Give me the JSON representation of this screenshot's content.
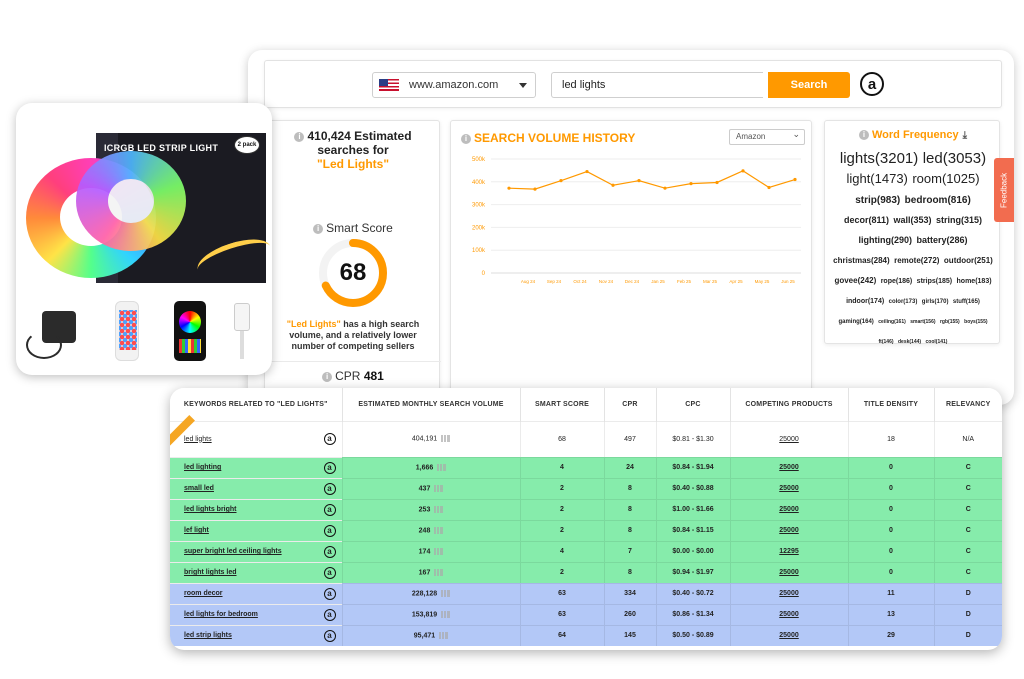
{
  "search": {
    "domain": "www.amazon.com",
    "keyword": "led lights",
    "button_label": "Search"
  },
  "stats": {
    "estimated_title": "410,424 Estimated searches for",
    "keyword_quoted": "\"Led Lights\"",
    "smart_score_label": "Smart Score",
    "smart_score": "68",
    "smart_score_value": 68,
    "desc_kw": "\"Led Lights\"",
    "desc_rest": " has a high search volume, and a relatively lower number of competing sellers",
    "cpr_label": "CPR",
    "cpr_value": "481"
  },
  "chart": {
    "title": "SEARCH VOLUME HISTORY",
    "select_value": "Amazon",
    "accent": "#ff9900"
  },
  "chart_data": {
    "type": "line",
    "title": "SEARCH VOLUME HISTORY",
    "x": [
      "Aug 24",
      "Sep 24",
      "Oct 24",
      "Nov 24",
      "Dec 24",
      "Jan 25",
      "Feb 25",
      "Mar 25",
      "Apr 25",
      "May 25",
      "Jun 25"
    ],
    "series": [
      {
        "values": [
          372000,
          368000,
          405000,
          445000,
          385000,
          405000,
          372000,
          392000,
          397000,
          448000,
          375000,
          410000
        ]
      }
    ],
    "ylim": [
      0,
      500000
    ],
    "yticks": [
      "0",
      "100k",
      "200k",
      "300k",
      "400k",
      "500k"
    ],
    "grid": true
  },
  "word_frequency": {
    "title": "Word Frequency",
    "words": [
      {
        "text": "lights(3201)",
        "size": 15,
        "bold": false
      },
      {
        "text": "led(3053)",
        "size": 15,
        "bold": false
      },
      {
        "text": "light(1473)",
        "size": 13,
        "bold": false
      },
      {
        "text": "room(1025)",
        "size": 13,
        "bold": false
      },
      {
        "text": "strip(983)",
        "size": 10,
        "bold": false
      },
      {
        "text": "bedroom(816)",
        "size": 10,
        "bold": false
      },
      {
        "text": "decor(811)",
        "size": 9,
        "bold": false
      },
      {
        "text": "wall(353)",
        "size": 9,
        "bold": false
      },
      {
        "text": "string(315)",
        "size": 9,
        "bold": false
      },
      {
        "text": "lighting(290)",
        "size": 9,
        "bold": false
      },
      {
        "text": "battery(286)",
        "size": 9,
        "bold": false
      },
      {
        "text": "christmas(284)",
        "size": 8,
        "bold": false
      },
      {
        "text": "remote(272)",
        "size": 8,
        "bold": false
      },
      {
        "text": "outdoor(251)",
        "size": 8,
        "bold": false
      },
      {
        "text": "govee(242)",
        "size": 8,
        "bold": false
      },
      {
        "text": "rope(186)",
        "size": 7,
        "bold": false
      },
      {
        "text": "strips(185)",
        "size": 7,
        "bold": false
      },
      {
        "text": "home(183)",
        "size": 7,
        "bold": false
      },
      {
        "text": "indoor(174)",
        "size": 7,
        "bold": false
      },
      {
        "text": "color(173)",
        "size": 6,
        "bold": false
      },
      {
        "text": "girls(170)",
        "size": 6,
        "bold": false
      },
      {
        "text": "stuff(165)",
        "size": 6,
        "bold": false
      },
      {
        "text": "gaming(164)",
        "size": 6,
        "bold": false
      },
      {
        "text": "ceiling(161)",
        "size": 5,
        "bold": false
      },
      {
        "text": "smart(156)",
        "size": 5,
        "bold": false
      },
      {
        "text": "rgb(155)",
        "size": 5,
        "bold": false
      },
      {
        "text": "boys(155)",
        "size": 5,
        "bold": false
      },
      {
        "text": "ft(146)",
        "size": 5,
        "bold": false
      },
      {
        "text": "desk(144)",
        "size": 5,
        "bold": false
      },
      {
        "text": "cool(141)",
        "size": 5,
        "bold": false
      }
    ]
  },
  "feedback_label": "Feedback",
  "product": {
    "box_title": "ICRGB LED STRIP LIGHT",
    "badge": "2 pack"
  },
  "table": {
    "headers": [
      "KEYWORDS RELATED TO \"LED LIGHTS\"",
      "ESTIMATED MONTHLY SEARCH VOLUME",
      "SMART SCORE",
      "CPR",
      "CPC",
      "COMPETING PRODUCTS",
      "TITLE DENSITY",
      "RELEVANCY"
    ],
    "rows": [
      {
        "style": "top",
        "keyword": "led lights",
        "volume": "404,191",
        "smart": "68",
        "cpr": "497",
        "cpc": "$0.81 - $1.30",
        "competing": "25000",
        "density": "18",
        "relevancy": "N/A"
      },
      {
        "style": "green",
        "keyword": "led lighting",
        "volume": "1,666",
        "smart": "4",
        "cpr": "24",
        "cpc": "$0.84 - $1.94",
        "competing": "25000",
        "density": "0",
        "relevancy": "C"
      },
      {
        "style": "green",
        "keyword": "small led",
        "volume": "437",
        "smart": "2",
        "cpr": "8",
        "cpc": "$0.40 - $0.88",
        "competing": "25000",
        "density": "0",
        "relevancy": "C"
      },
      {
        "style": "green",
        "keyword": "led lights bright",
        "volume": "253",
        "smart": "2",
        "cpr": "8",
        "cpc": "$1.00 - $1.66",
        "competing": "25000",
        "density": "0",
        "relevancy": "C"
      },
      {
        "style": "green",
        "keyword": "lef light",
        "volume": "248",
        "smart": "2",
        "cpr": "8",
        "cpc": "$0.84 - $1.15",
        "competing": "25000",
        "density": "0",
        "relevancy": "C"
      },
      {
        "style": "green",
        "keyword": "super bright led ceiling lights",
        "volume": "174",
        "smart": "4",
        "cpr": "7",
        "cpc": "$0.00 - $0.00",
        "competing": "12295",
        "density": "0",
        "relevancy": "C"
      },
      {
        "style": "green",
        "keyword": "bright lights led",
        "volume": "167",
        "smart": "2",
        "cpr": "8",
        "cpc": "$0.94 - $1.97",
        "competing": "25000",
        "density": "0",
        "relevancy": "C"
      },
      {
        "style": "blue",
        "keyword": "room decor",
        "volume": "228,128",
        "smart": "63",
        "cpr": "334",
        "cpc": "$0.40 - $0.72",
        "competing": "25000",
        "density": "11",
        "relevancy": "D"
      },
      {
        "style": "blue",
        "keyword": "led lights for bedroom",
        "volume": "153,819",
        "smart": "63",
        "cpr": "260",
        "cpc": "$0.86 - $1.34",
        "competing": "25000",
        "density": "13",
        "relevancy": "D"
      },
      {
        "style": "blue",
        "keyword": "led strip lights",
        "volume": "95,471",
        "smart": "64",
        "cpr": "145",
        "cpc": "$0.50 - $0.89",
        "competing": "25000",
        "density": "29",
        "relevancy": "D"
      }
    ]
  },
  "colors": {
    "accent": "#ff9900",
    "row_green": "#86ecab",
    "row_blue": "#b3c8f7",
    "feedback": "#f26c4f"
  }
}
